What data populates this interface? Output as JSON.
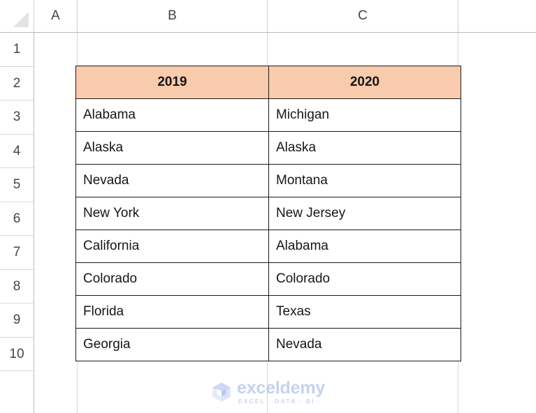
{
  "app": {
    "type": "spreadsheet",
    "select_all_label": ""
  },
  "grid": {
    "column_headers": [
      "A",
      "B",
      "C"
    ],
    "row_headers": [
      "1",
      "2",
      "3",
      "4",
      "5",
      "6",
      "7",
      "8",
      "9",
      "10"
    ]
  },
  "table": {
    "header_fill": "#F8CBAD",
    "border_color": "#1A1A1A",
    "columns": [
      "2019",
      "2020"
    ],
    "rows": [
      [
        "Alabama",
        "Michigan"
      ],
      [
        "Alaska",
        "Alaska"
      ],
      [
        "Nevada",
        "Montana"
      ],
      [
        "New York",
        "New Jersey"
      ],
      [
        "California",
        "Alabama"
      ],
      [
        "Colorado",
        "Colorado"
      ],
      [
        "Florida",
        "Texas"
      ],
      [
        "Georgia",
        "Nevada"
      ]
    ]
  },
  "watermark": {
    "name": "exceldemy",
    "tagline": "EXCEL - DATA - BI",
    "color": "#C3D3F0"
  }
}
